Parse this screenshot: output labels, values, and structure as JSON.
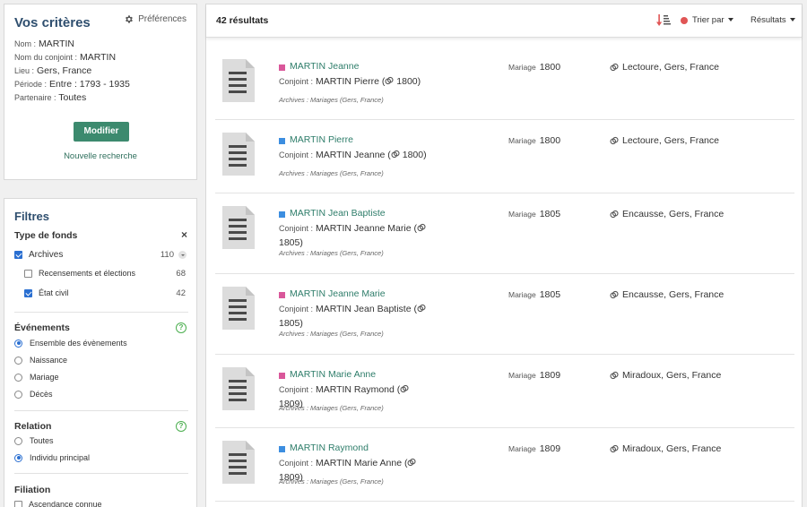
{
  "criteria": {
    "title": "Vos critères",
    "prefs_label": "Préférences",
    "lines": [
      {
        "key": "Nom :",
        "value": "MARTIN"
      },
      {
        "key": "Nom du conjoint :",
        "value": "MARTIN"
      },
      {
        "key": "Lieu :",
        "value": "Gers, France"
      },
      {
        "key": "Période :",
        "value": "Entre : 1793 - 1935"
      },
      {
        "key": "Partenaire :",
        "value": "Toutes"
      }
    ],
    "modify_label": "Modifier",
    "new_search_label": "Nouvelle recherche"
  },
  "filters": {
    "title": "Filtres",
    "fonds": {
      "heading": "Type de fonds",
      "close": "×",
      "archives": {
        "label": "Archives",
        "count": "110",
        "checked": true
      },
      "recensements": {
        "label": "Recensements et élections",
        "count": "68",
        "checked": false
      },
      "etat_civil": {
        "label": "État civil",
        "count": "42",
        "checked": true
      }
    },
    "events": {
      "heading": "Événements",
      "help": "?",
      "options": [
        "Ensemble des évènements",
        "Naissance",
        "Mariage",
        "Décès"
      ],
      "selected": 0
    },
    "relation": {
      "heading": "Relation",
      "help": "?",
      "options": [
        "Toutes",
        "Individu principal"
      ],
      "selected": 1
    },
    "filiation": {
      "heading": "Filiation",
      "option": "Ascendance connue"
    }
  },
  "results": {
    "count_label": "42 résultats",
    "sort_label": "Trier par",
    "results_label": "Résultats",
    "conjoint_key": "Conjoint :",
    "records": [
      {
        "gender": "f",
        "name": "MARTIN Jeanne",
        "spouse": "MARTIN Pierre",
        "year": "1800",
        "source": "Archives : Mariages (Gers, France)",
        "event_type": "Mariage",
        "event_year": "1800",
        "location": "Lectoure, Gers, France"
      },
      {
        "gender": "m",
        "name": "MARTIN Pierre",
        "spouse": "MARTIN Jeanne",
        "year": "1800",
        "source": "Archives : Mariages (Gers, France)",
        "event_type": "Mariage",
        "event_year": "1800",
        "location": "Lectoure, Gers, France"
      },
      {
        "gender": "m",
        "name": "MARTIN Jean Baptiste",
        "spouse": "MARTIN Jeanne Marie",
        "year": "1805",
        "source": "Archives : Mariages (Gers, France)",
        "event_type": "Mariage",
        "event_year": "1805",
        "location": "Encausse, Gers, France"
      },
      {
        "gender": "f",
        "name": "MARTIN Jeanne Marie",
        "spouse": "MARTIN Jean Baptiste",
        "year": "1805",
        "source": "Archives : Mariages (Gers, France)",
        "event_type": "Mariage",
        "event_year": "1805",
        "location": "Encausse, Gers, France"
      },
      {
        "gender": "f",
        "name": "MARTIN Marie Anne",
        "spouse": "MARTIN Raymond",
        "year": "1809",
        "source": "Archives : Mariages (Gers, France)",
        "event_type": "Mariage",
        "event_year": "1809",
        "location": "Miradoux, Gers, France"
      },
      {
        "gender": "m",
        "name": "MARTIN Raymond",
        "spouse": "MARTIN Marie Anne",
        "year": "1809",
        "source": "Archives : Mariages (Gers, France)",
        "event_type": "Mariage",
        "event_year": "1809",
        "location": "Miradoux, Gers, France"
      }
    ]
  },
  "icons": {
    "prefs": "gear-icon",
    "sort": "sort-desc-icon",
    "ring": "wedding-rings-icon",
    "record": "document-icon",
    "close": "close-icon"
  },
  "colors": {
    "accent": "#3c8a6e",
    "link": "#2e7d6a",
    "female": "#d9579a",
    "male": "#3c8ee0",
    "checkbox": "#2a6fd1",
    "sort_dot": "#e05555"
  }
}
